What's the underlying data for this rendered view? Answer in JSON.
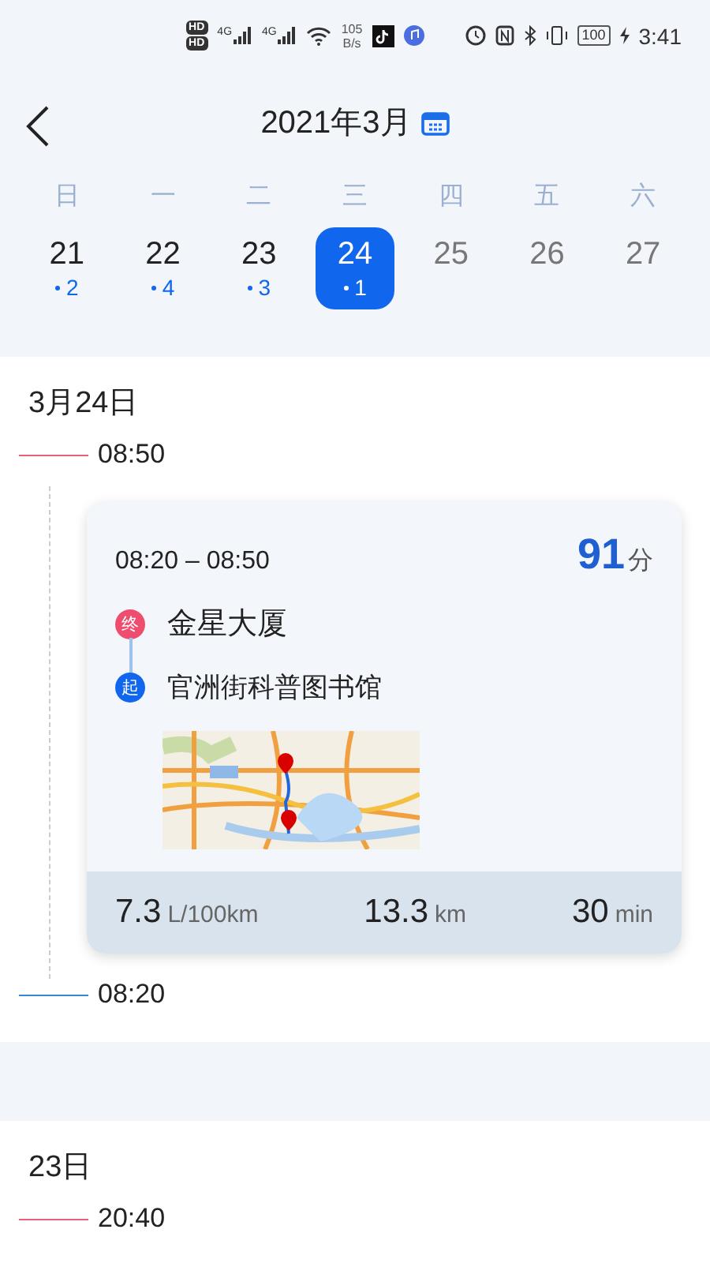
{
  "status_bar": {
    "hd_labels": [
      "HD",
      "HD"
    ],
    "network_labels": [
      "4G",
      "4G"
    ],
    "speed": "105",
    "speed_unit": "B/s",
    "battery": "100",
    "time": "3:41"
  },
  "header": {
    "title": "2021年3月"
  },
  "calendar": {
    "weekdays": [
      "日",
      "一",
      "二",
      "三",
      "四",
      "五",
      "六"
    ],
    "days": [
      {
        "day": "21",
        "count": "2",
        "selected": false,
        "disabled": false
      },
      {
        "day": "22",
        "count": "4",
        "selected": false,
        "disabled": false
      },
      {
        "day": "23",
        "count": "3",
        "selected": false,
        "disabled": false
      },
      {
        "day": "24",
        "count": "1",
        "selected": true,
        "disabled": false
      },
      {
        "day": "25",
        "selected": false,
        "disabled": true
      },
      {
        "day": "26",
        "selected": false,
        "disabled": true
      },
      {
        "day": "27",
        "selected": false,
        "disabled": true
      }
    ]
  },
  "groups": [
    {
      "date": "3月24日",
      "entries": [
        {
          "kind": "time",
          "time": "08:50",
          "color": "#e8607a"
        },
        {
          "kind": "trip",
          "time_range": "08:20 – 08:50",
          "score": "91",
          "score_unit": "分",
          "stops": [
            {
              "kind": "end",
              "badge": "终",
              "name": "金星大厦"
            },
            {
              "kind": "start",
              "badge": "起",
              "name": "官洲街科普图书馆"
            }
          ],
          "map": {
            "kind": "picture"
          },
          "stats": [
            {
              "value": "7.3",
              "unit": "L/100km"
            },
            {
              "value": "13.3",
              "unit": "km"
            },
            {
              "value": "30",
              "unit": "min"
            }
          ]
        },
        {
          "kind": "time",
          "time": "08:20",
          "color": "#3a86d6"
        }
      ]
    },
    {
      "date": "23日",
      "entries": [
        {
          "kind": "time",
          "time": "20:40",
          "color": "#e8607a"
        }
      ]
    }
  ]
}
